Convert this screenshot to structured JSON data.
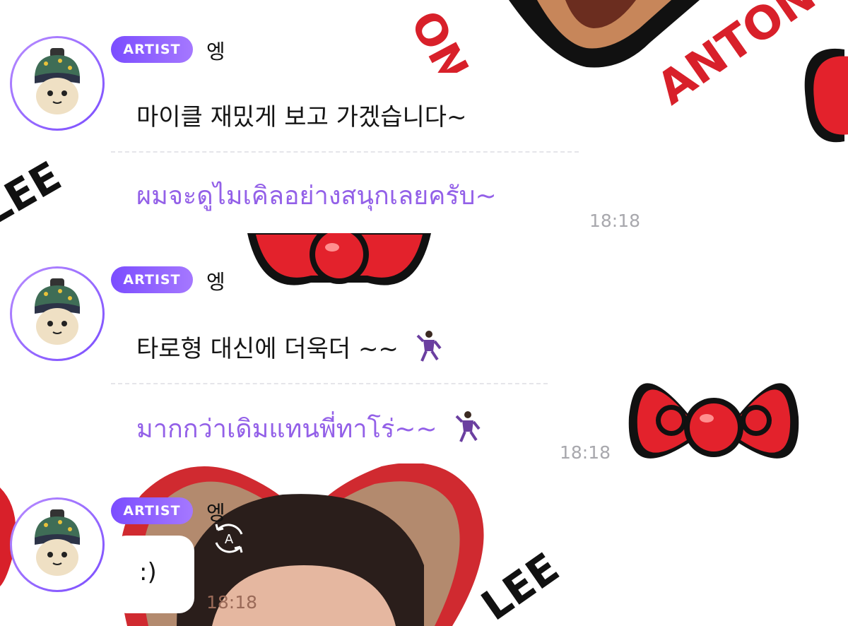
{
  "messages": [
    {
      "badge": "ARTIST",
      "name": "엥",
      "original_text": "마이클 재밌게 보고 가겠습니다~",
      "translated_text": "ผมจะดูไมเคิลอย่างสนุกเลยครับ~",
      "time": "18:18"
    },
    {
      "badge": "ARTIST",
      "name": "엥",
      "original_text": "타로형 대신에 더욱더 ~~",
      "translated_text": "มากกว่าเดิมแทนพี่ทาโร่~~",
      "time": "18:18",
      "emoji": "dancing-man-icon"
    },
    {
      "badge": "ARTIST",
      "name": "엥",
      "original_text": ":)",
      "time": "18:18"
    }
  ],
  "background": {
    "watermark_1": "ANTON LEE",
    "watermark_2": "LEE",
    "colors": {
      "red": "#d8202a",
      "black": "#111111",
      "purple": "#8b5cf6"
    }
  },
  "icons": {
    "avatar": "plush-doll-avatar-icon",
    "translate": "auto-translate-icon",
    "bow": "red-bow-icon"
  }
}
